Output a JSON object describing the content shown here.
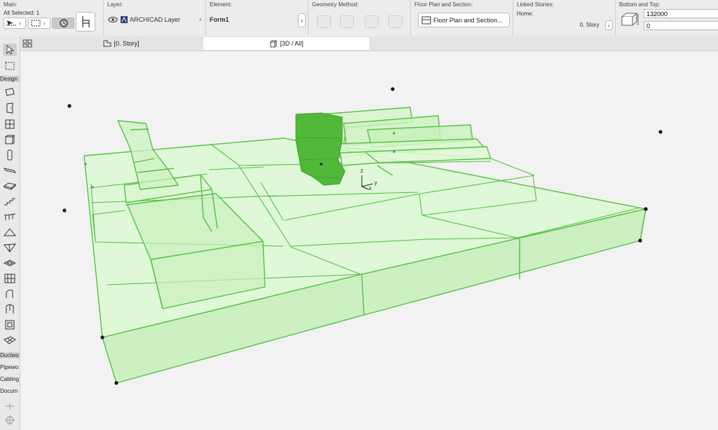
{
  "infobox": {
    "main": {
      "title": "Main:",
      "selection": "All Selected: 1"
    },
    "layer": {
      "title": "Layer:",
      "value": "ARCHICAD Layer"
    },
    "element": {
      "title": "Element:",
      "value": "Form1"
    },
    "geometry": {
      "title": "Geometry Method:"
    },
    "floor_plan": {
      "title": "Floor Plan and Section:",
      "value": "Floor Plan and Section..."
    },
    "linked": {
      "title": "Linked Stories:",
      "home_label": "Home:",
      "story": "0. Story"
    },
    "bottom_top": {
      "title": "Bottom and Top:",
      "top_value": "132000",
      "bottom_value": "0"
    }
  },
  "tabs": [
    {
      "label": "[0. Story]"
    },
    {
      "label": "[3D / All]"
    }
  ],
  "toolbox": {
    "design_label": "Design",
    "bottom_labels": [
      "Ductwo",
      "Pipewo",
      "Cabling",
      "Docum"
    ]
  },
  "colors": {
    "morph_edge": "#55c043",
    "morph_fill": "#c8f5bc",
    "selected_fill": "#52b83a"
  }
}
